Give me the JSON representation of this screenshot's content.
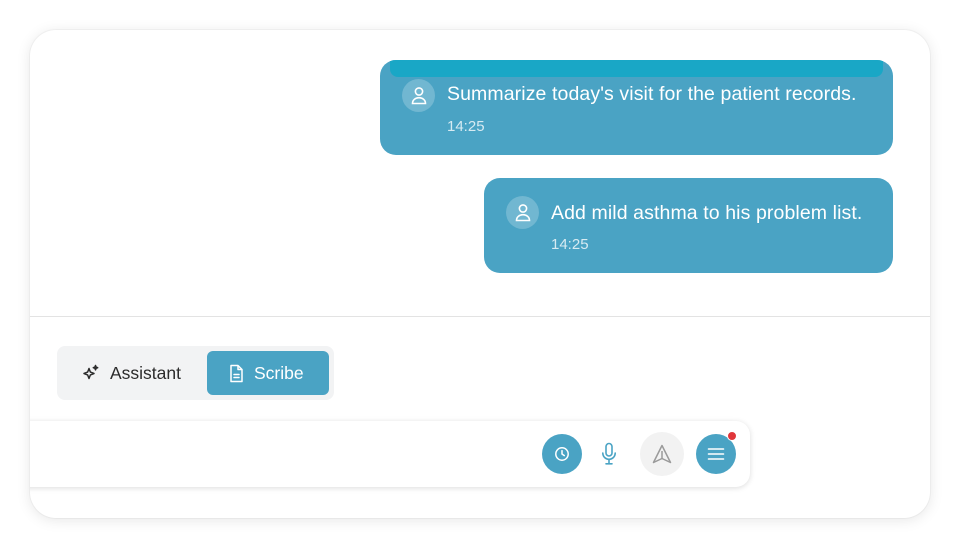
{
  "colors": {
    "accent": "#4aa3c4",
    "accent_strip": "#19a7c6",
    "notification": "#e0363b",
    "divider": "#e3e3e3"
  },
  "messages": [
    {
      "text": "Summarize today's visit for the patient records.",
      "time": "14:25",
      "avatar_icon": "user-icon"
    },
    {
      "text": "Add mild asthma to his problem list.",
      "time": "14:25",
      "avatar_icon": "user-icon"
    }
  ],
  "modes": {
    "assistant": {
      "label": "Assistant",
      "icon": "sparkle-icon",
      "active": false
    },
    "scribe": {
      "label": "Scribe",
      "icon": "document-icon",
      "active": true
    }
  },
  "composer": {
    "value": "",
    "buttons": {
      "history_icon": "clock-icon",
      "mic_icon": "microphone-icon",
      "send_icon": "send-icon",
      "menu_icon": "menu-icon"
    },
    "menu_notification": true
  }
}
